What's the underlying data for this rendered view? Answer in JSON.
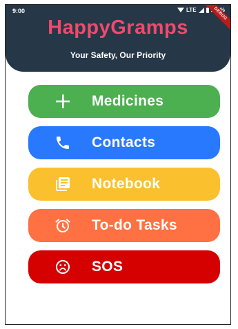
{
  "status_bar": {
    "time": "9:00",
    "network": "LTE",
    "battery": "100%"
  },
  "debug_banner": "DEBUG",
  "header": {
    "title": "HappyGramps",
    "subtitle": "Your Safety, Our Priority"
  },
  "menu": {
    "medicines": "Medicines",
    "contacts": "Contacts",
    "notebook": "Notebook",
    "todo": "To-do Tasks",
    "sos": "SOS"
  },
  "colors": {
    "header_bg": "#263747",
    "title": "#f04a6e",
    "medicines": "#4caf50",
    "contacts": "#2979ff",
    "notebook": "#fbc02d",
    "todo": "#ff7043",
    "sos": "#d50000"
  }
}
